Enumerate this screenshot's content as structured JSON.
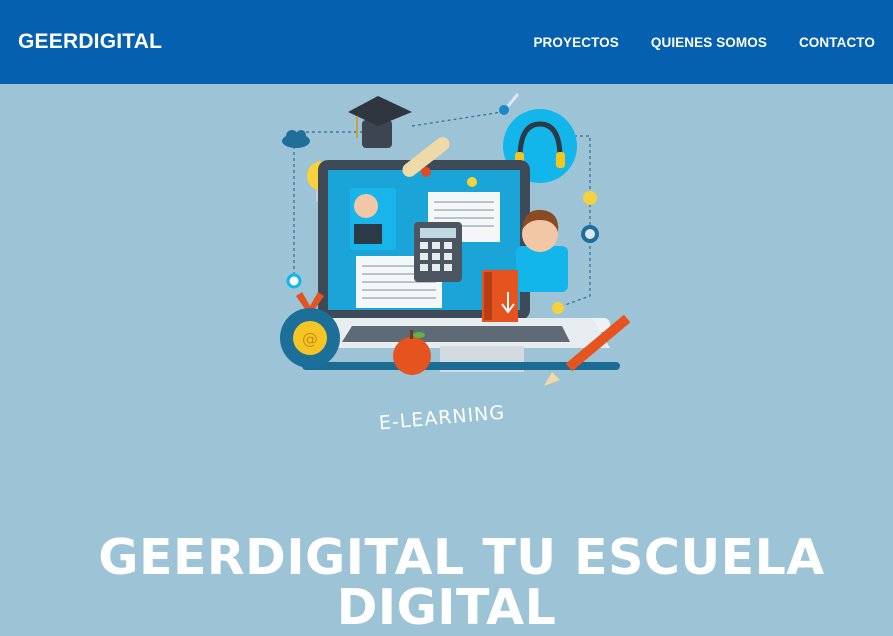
{
  "header": {
    "brand": "GEERDIGITAL",
    "nav": [
      {
        "label": "PROYECTOS"
      },
      {
        "label": "QUIENES SOMOS"
      },
      {
        "label": "CONTACTO"
      }
    ]
  },
  "hero": {
    "illustration_label": "E-LEARNING",
    "headline_line1": "GEERDIGITAL  TU ESCUELA",
    "headline_line2": "DIGITAL"
  },
  "colors": {
    "header_bg": "#0560b0",
    "page_bg": "#9cc3d6",
    "text": "#ffffff"
  }
}
